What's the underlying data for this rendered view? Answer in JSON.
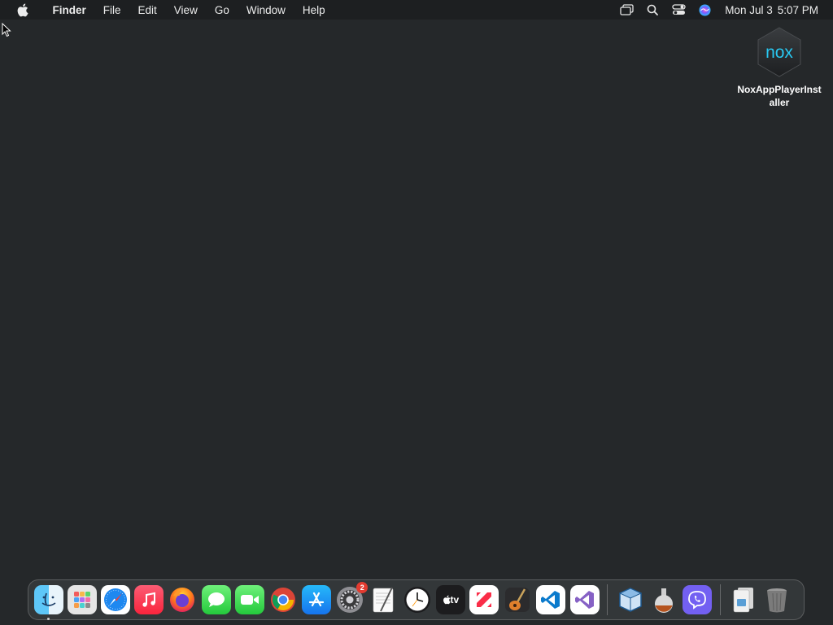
{
  "menubar": {
    "apple_icon": "apple-logo-icon",
    "items": [
      "Finder",
      "File",
      "Edit",
      "View",
      "Go",
      "Window",
      "Help"
    ],
    "status_icons": [
      "screen-mirroring-icon",
      "spotlight-search-icon",
      "control-center-icon",
      "siri-icon"
    ],
    "clock": {
      "day": "Mon Jul 3",
      "time": "5:07 PM"
    }
  },
  "desktop": {
    "background_color": "#25282a",
    "icons": [
      {
        "label": "NoxAppPlayerInstaller",
        "logo_text": "nox"
      }
    ]
  },
  "dock": {
    "apps": [
      {
        "name": "Finder",
        "icon": "finder-icon",
        "running": true
      },
      {
        "name": "Launchpad",
        "icon": "launchpad-icon"
      },
      {
        "name": "Safari",
        "icon": "safari-icon"
      },
      {
        "name": "Music",
        "icon": "music-icon"
      },
      {
        "name": "Firefox",
        "icon": "firefox-icon"
      },
      {
        "name": "Messages",
        "icon": "messages-icon"
      },
      {
        "name": "FaceTime",
        "icon": "facetime-icon"
      },
      {
        "name": "Google Chrome",
        "icon": "chrome-icon"
      },
      {
        "name": "App Store",
        "icon": "app-store-icon"
      },
      {
        "name": "System Preferences",
        "icon": "system-preferences-icon",
        "badge": "2"
      },
      {
        "name": "TextEdit",
        "icon": "textedit-icon"
      },
      {
        "name": "Clock",
        "icon": "clock-icon"
      },
      {
        "name": "Apple TV",
        "icon": "apple-tv-icon",
        "text": "tv"
      },
      {
        "name": "News",
        "icon": "news-icon"
      },
      {
        "name": "GarageBand",
        "icon": "garageband-icon"
      },
      {
        "name": "Visual Studio Code",
        "icon": "vscode-icon"
      },
      {
        "name": "Visual Studio",
        "icon": "visual-studio-icon"
      },
      {
        "name": "VirtualBox",
        "icon": "virtualbox-icon"
      },
      {
        "name": "Potion",
        "icon": "potion-flask-icon"
      },
      {
        "name": "Viber",
        "icon": "viber-icon"
      },
      {
        "name": "Downloads",
        "icon": "downloads-stack-icon"
      },
      {
        "name": "Trash",
        "icon": "trash-icon"
      }
    ]
  }
}
